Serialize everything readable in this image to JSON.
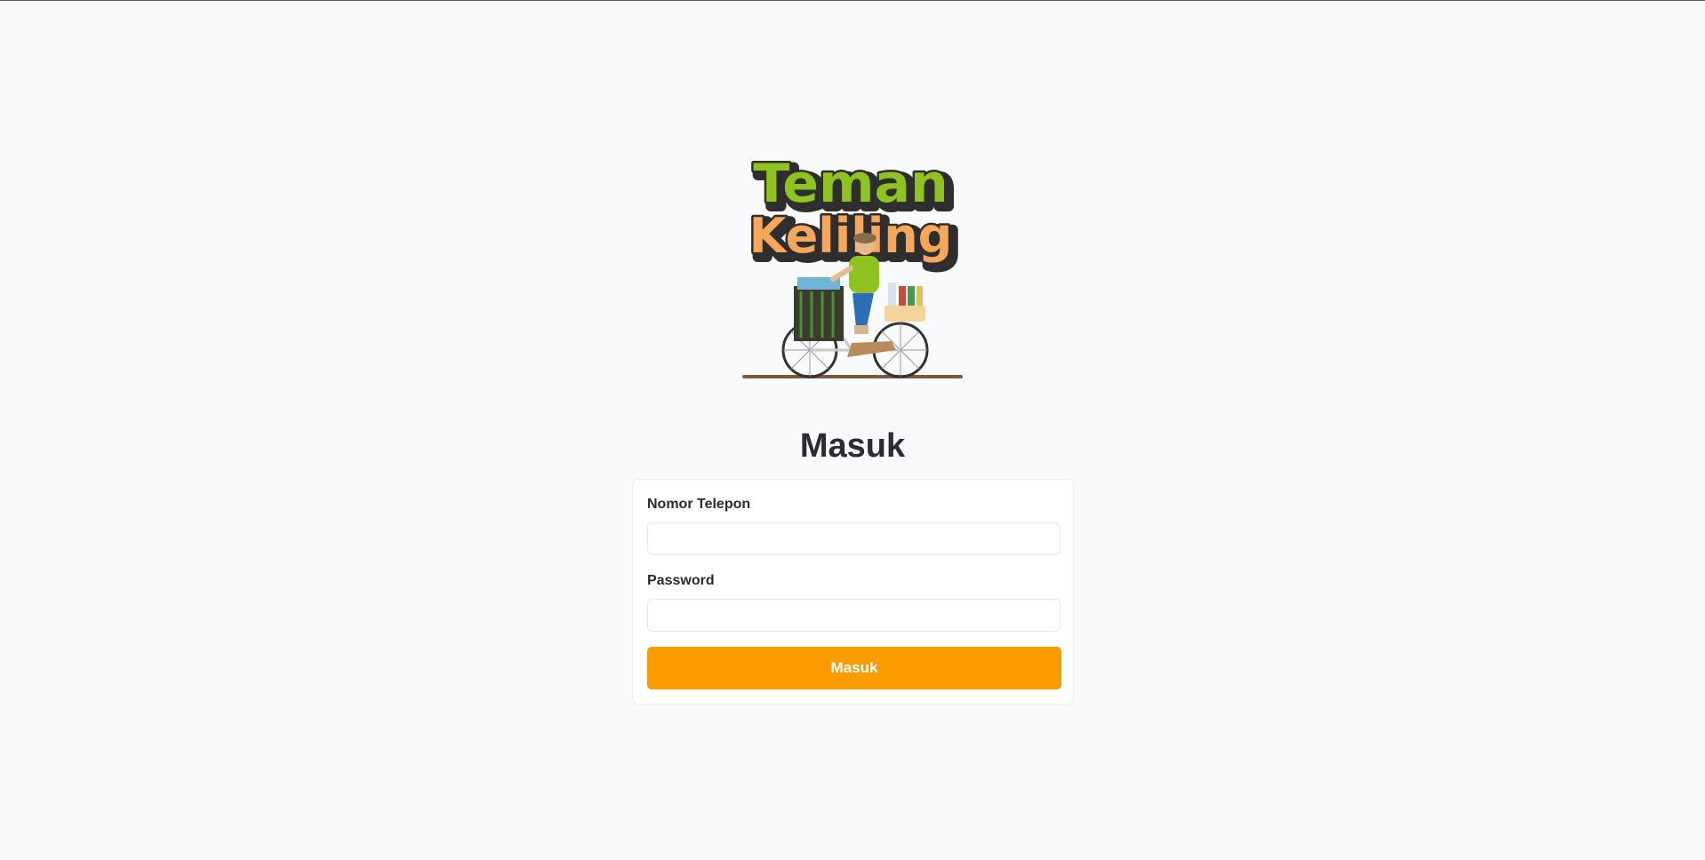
{
  "logo": {
    "line1": "Teman",
    "line2": "Keliling"
  },
  "page": {
    "title": "Masuk"
  },
  "form": {
    "phone_label": "Nomor Telepon",
    "phone_value": "",
    "password_label": "Password",
    "password_value": "",
    "submit_label": "Masuk"
  },
  "colors": {
    "background": "#f9fafb",
    "accent": "#fa9c00",
    "logo_green": "#8fc31f",
    "logo_orange": "#f7a75a",
    "text": "#2b2b33"
  }
}
